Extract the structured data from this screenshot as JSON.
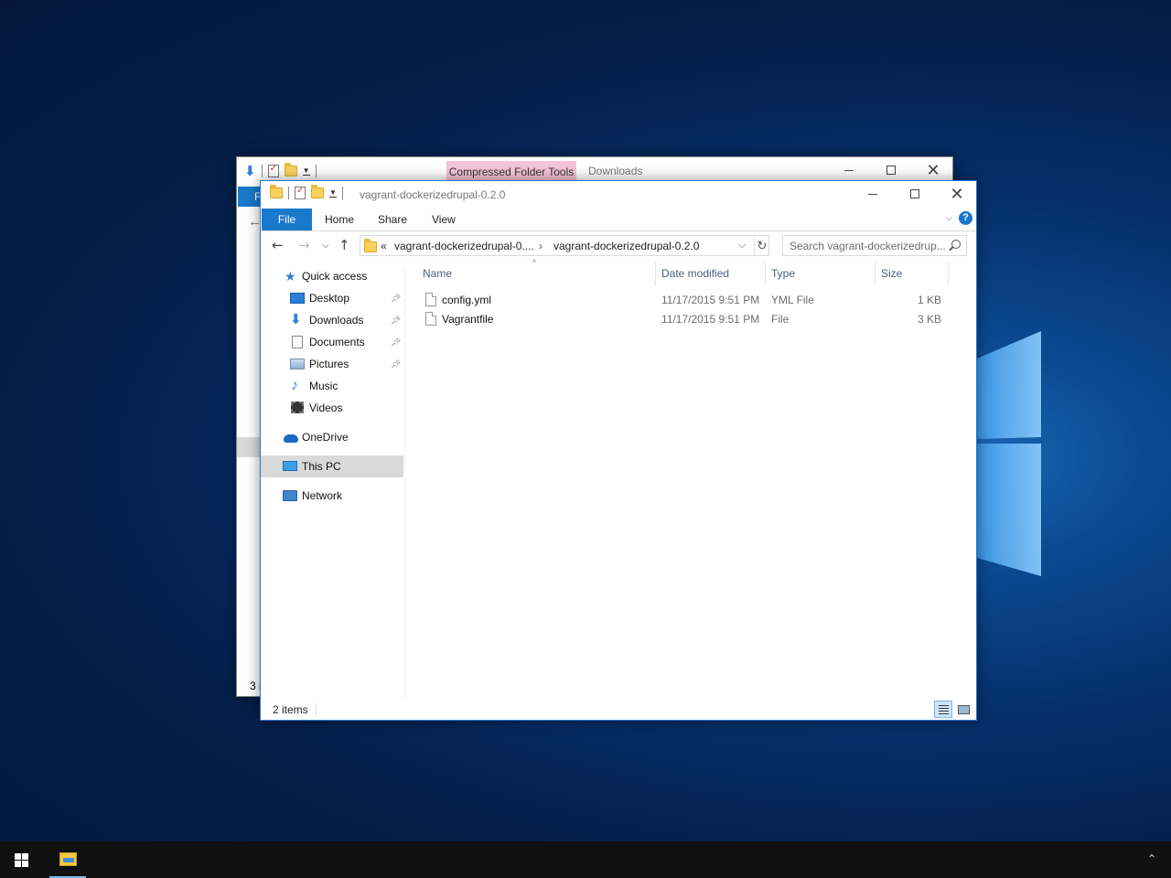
{
  "desktop": {
    "colors": {
      "accent": "#1979ca",
      "taskbar": "#101010",
      "compressed_tab": "#f6c4d7"
    }
  },
  "back_window": {
    "contextual_tab": "Compressed Folder Tools",
    "title": "Downloads",
    "file_tab_fragment": "F",
    "status_fragment": "3 i"
  },
  "window": {
    "title": "vagrant-dockerizedrupal-0.2.0",
    "tabs": [
      "File",
      "Home",
      "Share",
      "View"
    ],
    "address": {
      "overflow": "«",
      "crumbs": [
        "vagrant-dockerizedrupal-0....",
        "vagrant-dockerizedrupal-0.2.0"
      ],
      "separator": "›"
    },
    "search": {
      "placeholder": "Search vagrant-dockerizedrup..."
    },
    "nav": {
      "quick_access": "Quick access",
      "items": [
        {
          "label": "Desktop",
          "icon": "desktop-icon",
          "pinned": true
        },
        {
          "label": "Downloads",
          "icon": "downloads-icon",
          "pinned": true
        },
        {
          "label": "Documents",
          "icon": "documents-icon",
          "pinned": true
        },
        {
          "label": "Pictures",
          "icon": "pictures-icon",
          "pinned": true
        },
        {
          "label": "Music",
          "icon": "music-icon",
          "pinned": false
        },
        {
          "label": "Videos",
          "icon": "videos-icon",
          "pinned": false
        }
      ],
      "onedrive": "OneDrive",
      "this_pc": "This PC",
      "network": "Network"
    },
    "columns": {
      "name": "Name",
      "date": "Date modified",
      "type": "Type",
      "size": "Size"
    },
    "files": [
      {
        "name": "config.yml",
        "date": "11/17/2015 9:51 PM",
        "type": "YML File",
        "size": "1 KB"
      },
      {
        "name": "Vagrantfile",
        "date": "11/17/2015 9:51 PM",
        "type": "File",
        "size": "3 KB"
      }
    ],
    "status": "2 items"
  }
}
